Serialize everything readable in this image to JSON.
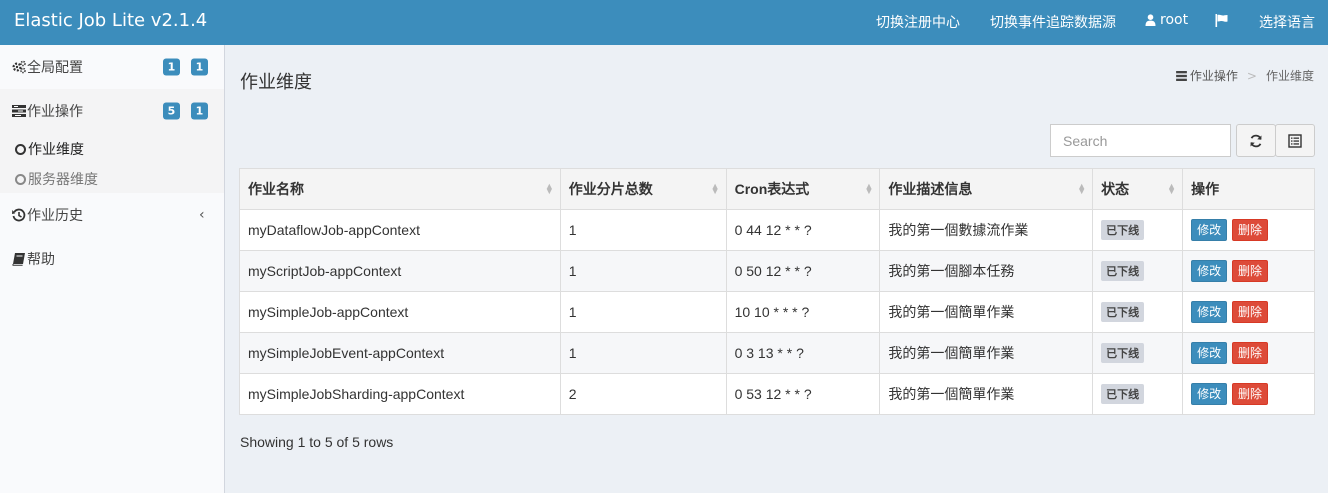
{
  "header": {
    "brand": "Elastic Job Lite v2.1.4",
    "nav": {
      "registry": "切换注册中心",
      "datasource": "切换事件追踪数据源",
      "user": "root",
      "language": "选择语言"
    }
  },
  "sidebar": {
    "global_config": {
      "label": "全局配置",
      "badge1": "1",
      "badge2": "1"
    },
    "job_ops": {
      "label": "作业操作",
      "badge1": "5",
      "badge2": "1"
    },
    "job_dimension": "作业维度",
    "server_dimension": "服务器维度",
    "job_history": "作业历史",
    "help": "帮助"
  },
  "main": {
    "title": "作业维度",
    "breadcrumb": {
      "parent": "作业操作",
      "separator": ">",
      "current": "作业维度"
    },
    "search_placeholder": "Search",
    "showing": "Showing 1 to 5 of 5 rows"
  },
  "table": {
    "headers": [
      "作业名称",
      "作业分片总数",
      "Cron表达式",
      "作业描述信息",
      "状态",
      "操作"
    ],
    "rows": [
      {
        "name": "myDataflowJob-appContext",
        "shards": "1",
        "cron": "0 44 12 * * ?",
        "desc": "我的第一個數據流作業",
        "status": "已下线",
        "edit": "修改",
        "delete": "删除"
      },
      {
        "name": "myScriptJob-appContext",
        "shards": "1",
        "cron": "0 50 12 * * ?",
        "desc": "我的第一個腳本任務",
        "status": "已下线",
        "edit": "修改",
        "delete": "删除"
      },
      {
        "name": "mySimpleJob-appContext",
        "shards": "1",
        "cron": "10 10 * * * ?",
        "desc": "我的第一個簡單作業",
        "status": "已下线",
        "edit": "修改",
        "delete": "删除"
      },
      {
        "name": "mySimpleJobEvent-appContext",
        "shards": "1",
        "cron": "0 3 13 * * ?",
        "desc": "我的第一個簡單作業",
        "status": "已下线",
        "edit": "修改",
        "delete": "删除"
      },
      {
        "name": "mySimpleJobSharding-appContext",
        "shards": "2",
        "cron": "0 53 12 * * ?",
        "desc": "我的第一個簡單作業",
        "status": "已下线",
        "edit": "修改",
        "delete": "删除"
      }
    ]
  },
  "colors": {
    "header_bg": "#3c8dbc",
    "badge": "#3c8dbc",
    "edit_button": "#3c8dbc",
    "delete_button": "#dd4b39",
    "status_label": "#d2d6de"
  },
  "icons": {
    "user": "user-icon",
    "language": "flag-icon",
    "global_config": "gears-icon",
    "job_ops": "tasks-icon",
    "job_history": "history-icon",
    "help": "book-icon",
    "refresh": "refresh-icon",
    "columns": "list-columns-icon"
  }
}
